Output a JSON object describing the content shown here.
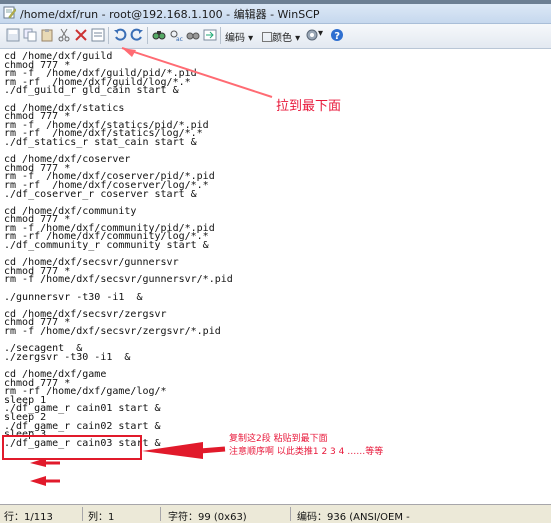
{
  "window": {
    "title": "/home/dxf/run - root@192.168.1.100 - 编辑器 - WinSCP"
  },
  "toolbar": {
    "encoding_label": "编码",
    "color_label": "颜色"
  },
  "editor": {
    "lines": [
      "cd /home/dxf/guild",
      "chmod 777 *",
      "rm -f  /home/dxf/guild/pid/*.pid",
      "rm -rf  /home/dxf/guild/log/*.*",
      "./df_guild_r gld_cain start &",
      "",
      "cd /home/dxf/statics",
      "chmod 777 *",
      "rm -f  /home/dxf/statics/pid/*.pid",
      "rm -rf  /home/dxf/statics/log/*.*",
      "./df_statics_r stat_cain start &",
      "",
      "cd /home/dxf/coserver",
      "chmod 777 *",
      "rm -f  /home/dxf/coserver/pid/*.pid",
      "rm -rf  /home/dxf/coserver/log/*.*",
      "./df_coserver_r coserver start &",
      "",
      "cd /home/dxf/community",
      "chmod 777 *",
      "rm -f /home/dxf/community/pid/*.pid",
      "rm -rf /home/dxf/community/log/*.*",
      "./df_community_r community start &",
      "",
      "cd /home/dxf/secsvr/gunnersvr",
      "chmod 777 *",
      "rm -f /home/dxf/secsvr/gunnersvr/*.pid",
      "",
      "./gunnersvr -t30 -i1  &",
      "",
      "cd /home/dxf/secsvr/zergsvr",
      "chmod 777 *",
      "rm -f /home/dxf/secsvr/zergsvr/*.pid",
      "",
      "./secagent  &",
      "./zergsvr -t30 -i1  &",
      "",
      "cd /home/dxf/game",
      "chmod 777 *",
      "rm -rf /home/dxf/game/log/*",
      "sleep 1",
      "./df_game_r cain01 start &",
      "sleep 2",
      "./df_game_r cain02 start &",
      "sleep 3",
      "./df_game_r cain03 start &"
    ]
  },
  "annotations": {
    "scroll_note": "拉到最下面",
    "copy_note_1": "复制这2段 粘贴到最下面",
    "copy_note_2": "注意顺序啊 以此类推1 2 3 4 ……等等"
  },
  "statusbar": {
    "line": "行：1/113",
    "column": "列：1",
    "char": "字符：99 (0x63)",
    "encoding": "编码：936  (ANSI/OEM -"
  },
  "colors": {
    "annotation": "#e8193b",
    "titlebar": "#c6d8ee"
  }
}
